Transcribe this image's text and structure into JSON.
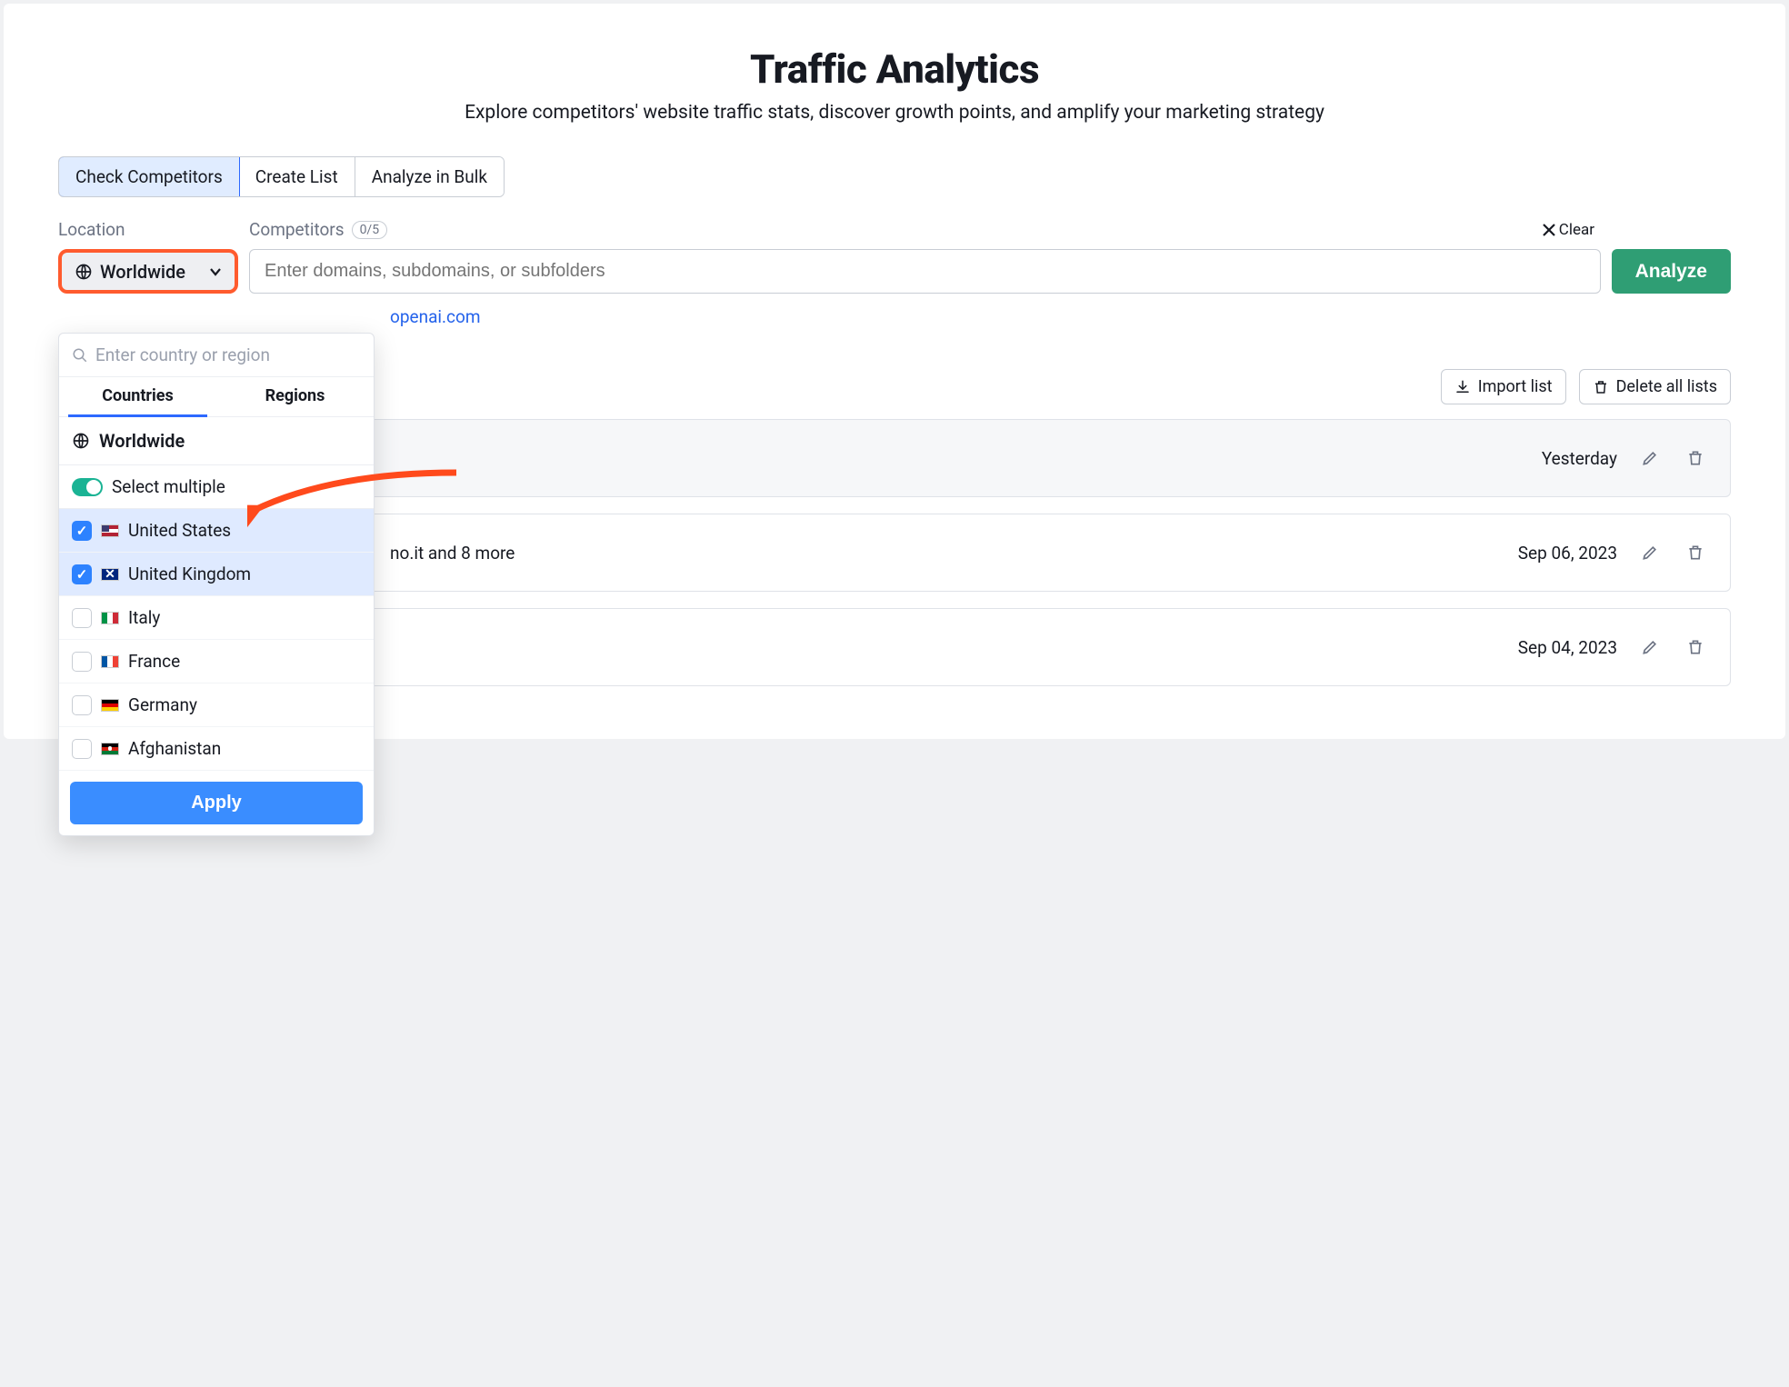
{
  "header": {
    "title": "Traffic Analytics",
    "subtitle": "Explore competitors' website traffic stats, discover growth points, and amplify your marketing strategy"
  },
  "tabs": {
    "check": "Check Competitors",
    "create": "Create List",
    "bulk": "Analyze in Bulk"
  },
  "labels": {
    "location": "Location",
    "competitors": "Competitors",
    "counter": "0/5",
    "clear": "Clear"
  },
  "location_button": "Worldwide",
  "domain_placeholder": "Enter domains, subdomains, or subfolders",
  "analyze": "Analyze",
  "example_link": "openai.com",
  "dropdown": {
    "search_placeholder": "Enter country or region",
    "tab_countries": "Countries",
    "tab_regions": "Regions",
    "worldwide": "Worldwide",
    "select_multiple": "Select multiple",
    "apply": "Apply",
    "countries": [
      {
        "name": "United States",
        "checked": true,
        "flag": "flag-us"
      },
      {
        "name": "United Kingdom",
        "checked": true,
        "flag": "flag-uk"
      },
      {
        "name": "Italy",
        "checked": false,
        "flag": "flag-it"
      },
      {
        "name": "France",
        "checked": false,
        "flag": "flag-fr"
      },
      {
        "name": "Germany",
        "checked": false,
        "flag": "flag-de"
      },
      {
        "name": "Afghanistan",
        "checked": false,
        "flag": "flag-af"
      }
    ]
  },
  "toolbar": {
    "import": "Import list",
    "delete_all": "Delete all lists"
  },
  "lists": [
    {
      "date": "Yesterday",
      "extra": ""
    },
    {
      "date": "Sep 06, 2023",
      "extra": "no.it and 8 more"
    },
    {
      "date": "Sep 04, 2023",
      "extra": ""
    }
  ]
}
